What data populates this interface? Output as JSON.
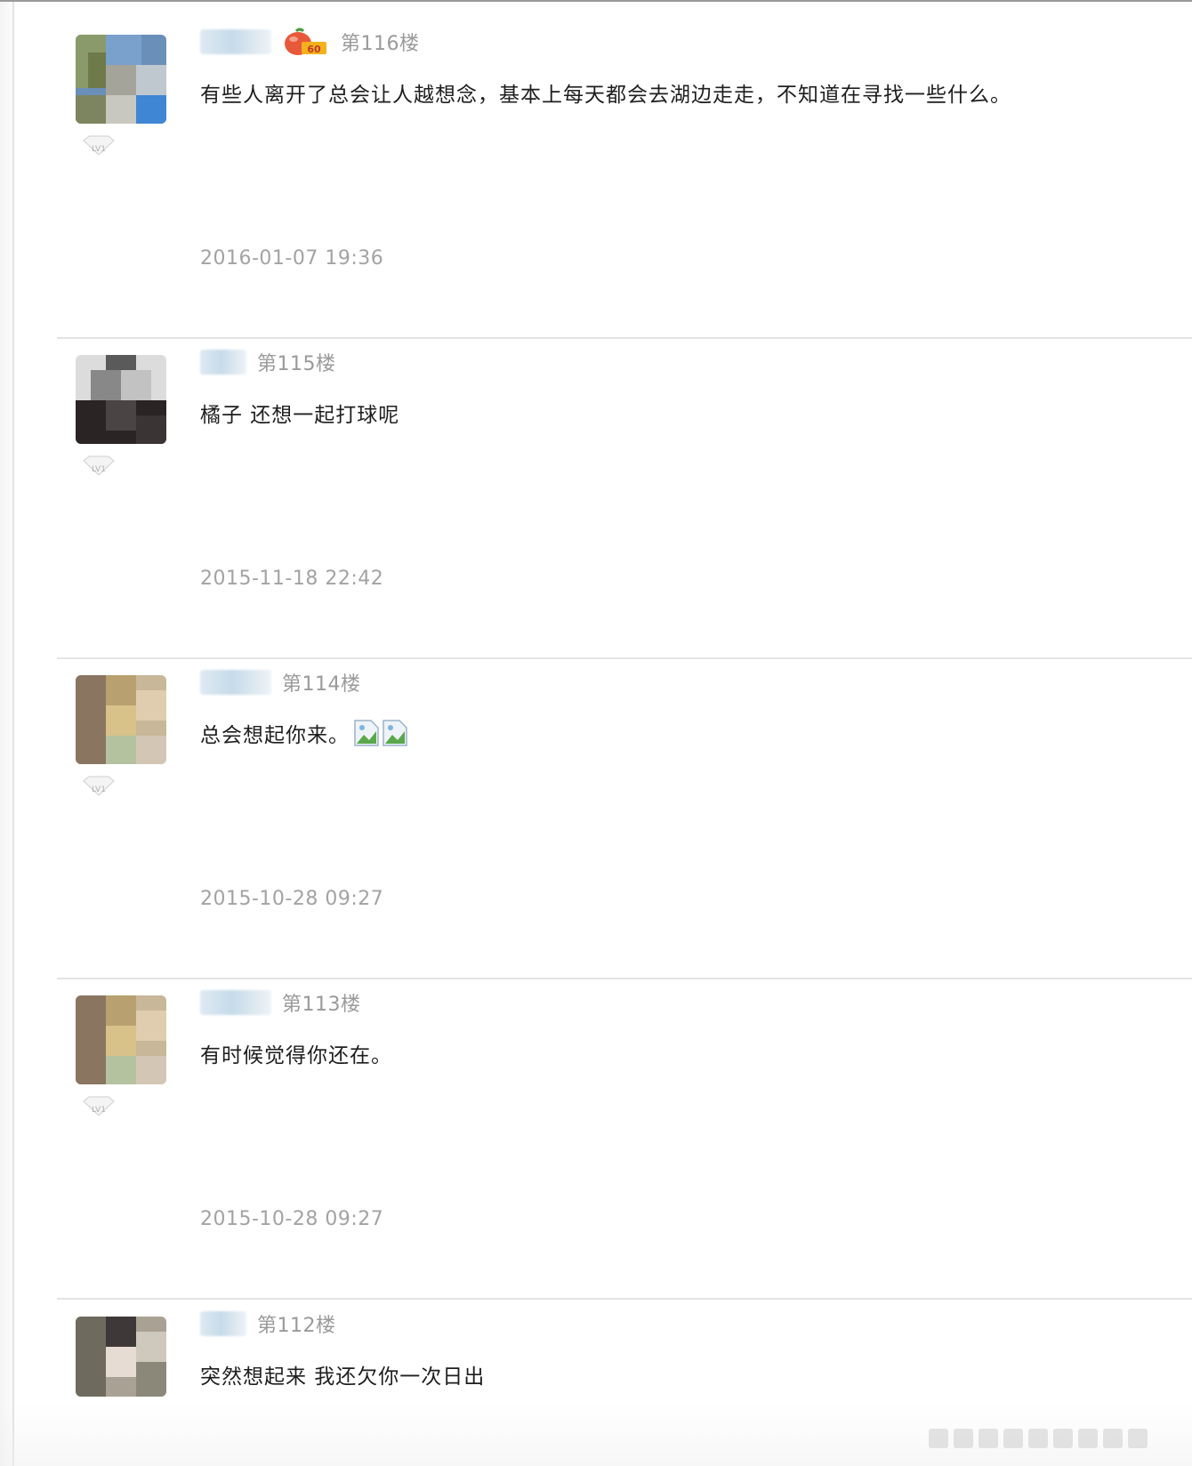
{
  "posts": [
    {
      "floor": "第116楼",
      "content": "有些人离开了总会让人越想念，基本上每天都会去湖边走走，不知道在寻找一些什么。",
      "timestamp": "2016-01-07 19:36",
      "level": "LV1",
      "has_vip_badge": true,
      "vip_badge_text": "60",
      "emoji_count": 0
    },
    {
      "floor": "第115楼",
      "content": "橘子 还想一起打球呢",
      "timestamp": "2015-11-18 22:42",
      "level": "LV1",
      "has_vip_badge": false,
      "emoji_count": 0
    },
    {
      "floor": "第114楼",
      "content": "总会想起你来。",
      "timestamp": "2015-10-28 09:27",
      "level": "LV1",
      "has_vip_badge": false,
      "emoji_count": 2
    },
    {
      "floor": "第113楼",
      "content": "有时候觉得你还在。",
      "timestamp": "2015-10-28 09:27",
      "level": "LV1",
      "has_vip_badge": false,
      "emoji_count": 0
    },
    {
      "floor": "第112楼",
      "content": "突然想起来 我还欠你一次日出",
      "timestamp": "",
      "level": "LV1",
      "has_vip_badge": false,
      "emoji_count": 0
    }
  ],
  "colors": {
    "floor_text": "#9a9a9a",
    "timestamp_text": "#a3a3a3",
    "content_text": "#1e1e1e",
    "divider": "#e4e4e4",
    "vip_orange": "#e8583a"
  }
}
